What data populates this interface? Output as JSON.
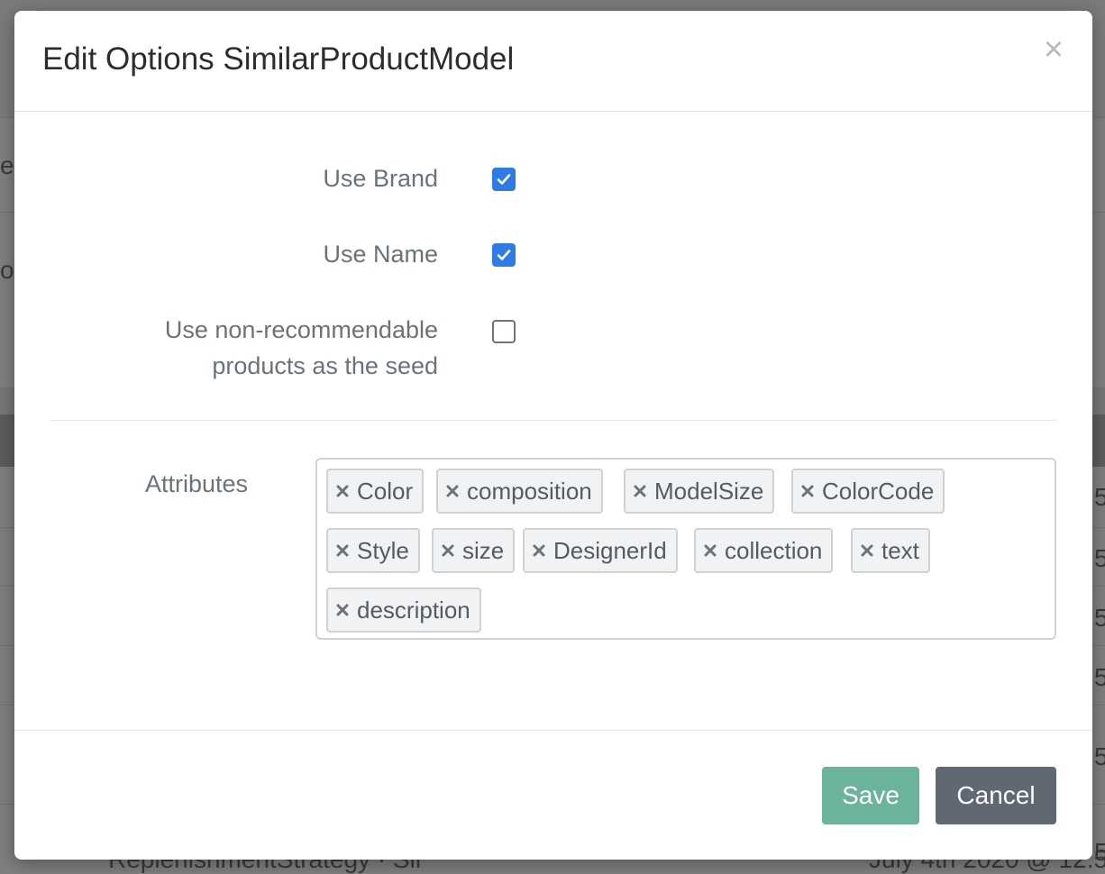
{
  "background": {
    "fragments": [
      "e",
      "or",
      "5",
      "5",
      "5",
      "5",
      "5",
      "5"
    ],
    "bottom_left": "ReplenishmentStrategy · Sil",
    "bottom_right": "July 4th 2020 @ 12:5"
  },
  "modal": {
    "title": "Edit Options SimilarProductModel",
    "close_label": "×",
    "checkboxes": [
      {
        "label": "Use Brand",
        "checked": true
      },
      {
        "label": "Use Name",
        "checked": true
      },
      {
        "label_line1": "Use non-recommendable",
        "label_line2": "products as the seed",
        "checked": false
      }
    ],
    "attributes_label": "Attributes",
    "attributes": [
      "Color",
      "composition",
      "ModelSize",
      "ColorCode",
      "Style",
      "size",
      "DesignerId",
      "collection",
      "text",
      "description"
    ],
    "save_label": "Save",
    "cancel_label": "Cancel"
  },
  "colors": {
    "accent": "#2f7be5",
    "save": "#6bb49a",
    "cancel": "#5f6873"
  }
}
